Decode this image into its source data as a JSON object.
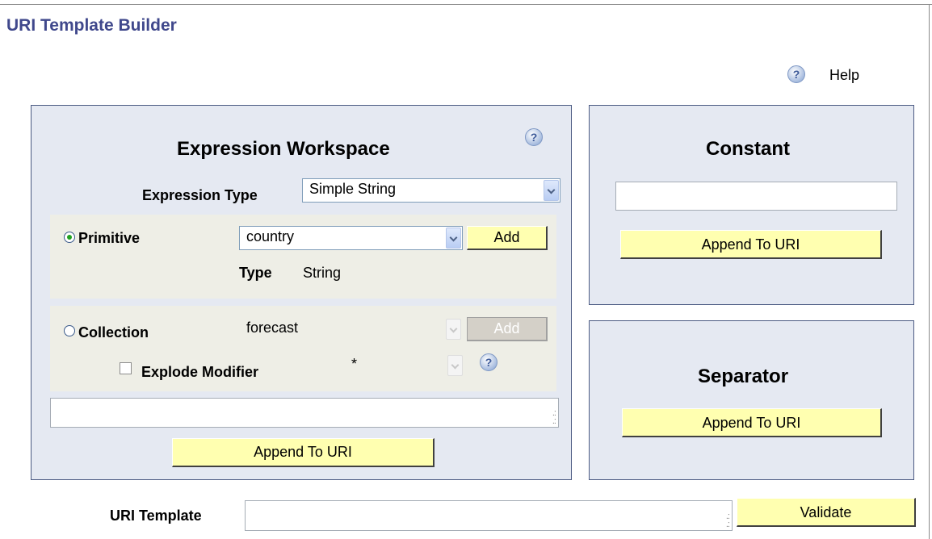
{
  "page": {
    "title": "URI Template Builder",
    "help_label": "Help"
  },
  "workspace": {
    "title": "Expression Workspace",
    "expression_type_label": "Expression Type",
    "expression_type_value": "Simple String",
    "primitive": {
      "label": "Primitive",
      "selected": true,
      "value": "country",
      "add_label": "Add",
      "type_label": "Type",
      "type_value": "String"
    },
    "collection": {
      "label": "Collection",
      "selected": false,
      "value": "forecast",
      "add_label": "Add",
      "explode_label": "Explode Modifier",
      "explode_checked": false,
      "explode_value": "*"
    },
    "expression_text": "",
    "append_label": "Append To URI"
  },
  "constant": {
    "title": "Constant",
    "value": "",
    "append_label": "Append To URI"
  },
  "separator": {
    "title": "Separator",
    "append_label": "Append To URI"
  },
  "uri_template": {
    "label": "URI Template",
    "value": "",
    "validate_label": "Validate"
  },
  "colors": {
    "title": "#40488c",
    "panel_bg": "#e5e9f2",
    "subpanel_bg": "#eeeee6",
    "button_bg": "#ffffb0"
  }
}
